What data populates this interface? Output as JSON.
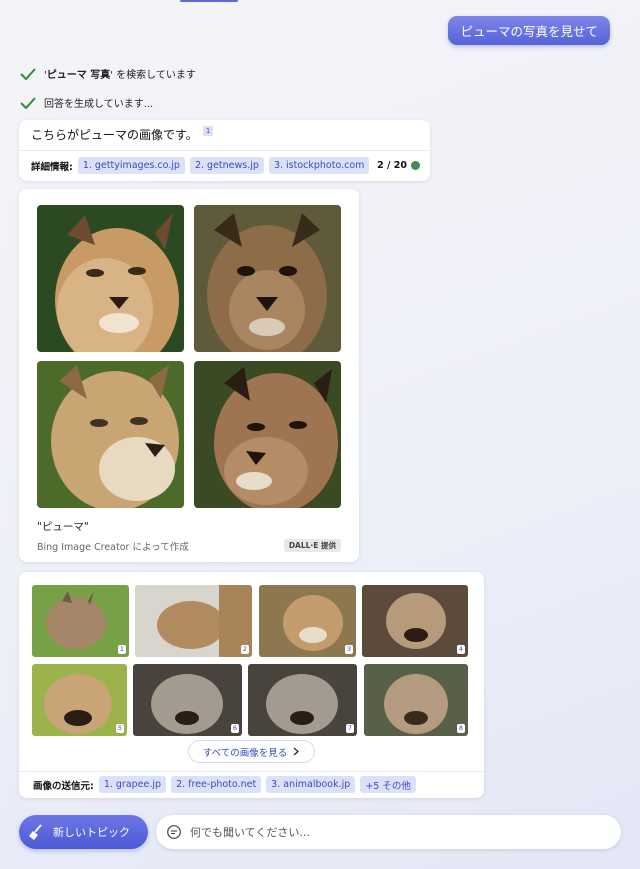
{
  "user_message": "ピューマの写真を見せて",
  "progress": [
    {
      "prefix": "'",
      "bold": "ピューマ 写真",
      "suffix": "' を検索しています"
    },
    {
      "prefix": "",
      "bold": "",
      "suffix": "回答を生成しています..."
    }
  ],
  "answer": {
    "text": "こちらがピューマの画像です。",
    "ref": "1",
    "details_label": "詳細情報:",
    "sources": [
      "1. gettyimages.co.jp",
      "2. getnews.jp",
      "3. istockphoto.com"
    ],
    "page_count": "2 / 20",
    "status_color": "#3f8c54"
  },
  "generated": {
    "caption": "\"ピューマ\"",
    "subtitle": "Bing Image Creator によって作成",
    "badge": "DALL·E 提供",
    "images": [
      {
        "name": "puma-portrait-1",
        "palette": [
          "#2c4a21",
          "#c79a66",
          "#3a2a1a"
        ]
      },
      {
        "name": "puma-portrait-2",
        "palette": [
          "#5f5a3a",
          "#8d6c48",
          "#2e2418"
        ]
      },
      {
        "name": "puma-portrait-3",
        "palette": [
          "#4c6a2a",
          "#c9a574",
          "#e7dac0"
        ]
      },
      {
        "name": "puma-portrait-4",
        "palette": [
          "#3a4a22",
          "#9f7450",
          "#2a1d13"
        ]
      }
    ]
  },
  "web_images": {
    "thumbs": [
      {
        "num": "1",
        "palette": [
          "#78a047",
          "#a58668"
        ]
      },
      {
        "num": "2",
        "palette": [
          "#d8d5cd",
          "#b28a5f"
        ]
      },
      {
        "num": "3",
        "palette": [
          "#8c7750",
          "#c49b6c"
        ]
      },
      {
        "num": "4",
        "palette": [
          "#5c4a3a",
          "#b69a7a"
        ]
      },
      {
        "num": "5",
        "palette": [
          "#9bb34a",
          "#c8a476"
        ]
      },
      {
        "num": "6",
        "palette": [
          "#48433d",
          "#a39b8f"
        ]
      },
      {
        "num": "7",
        "palette": [
          "#48433d",
          "#a39b8f"
        ]
      },
      {
        "num": "8",
        "palette": [
          "#59604a",
          "#b49a7f"
        ]
      }
    ],
    "see_all": "すべての画像を見る",
    "sources_label": "画像の送信元:",
    "sources": [
      "1. grapee.jp",
      "2. free-photo.net",
      "3. animalbook.jp",
      "+5 その他"
    ]
  },
  "new_topic": "新しいトピック",
  "input_placeholder": "何でも聞いてください...",
  "colors": {
    "accent": "#5563d8",
    "chip_bg": "#dbe1f8",
    "chip_text": "#3a4bbf"
  }
}
